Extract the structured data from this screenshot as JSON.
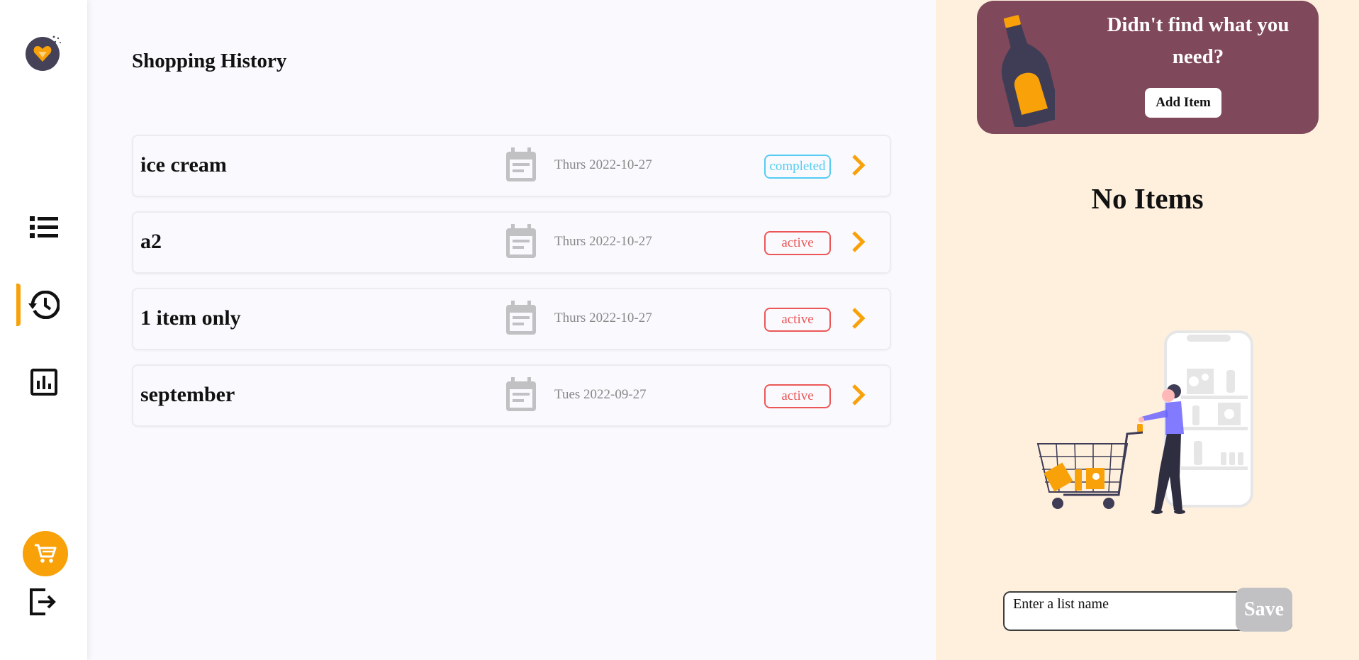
{
  "sidebar": {
    "items": [
      {
        "icon": "list-icon",
        "active": false
      },
      {
        "icon": "history-icon",
        "active": true
      },
      {
        "icon": "statistics-icon",
        "active": false
      }
    ]
  },
  "main": {
    "title": "Shopping History",
    "lists": [
      {
        "name": "ice cream",
        "date": "Thurs 2022-10-27",
        "status": "completed"
      },
      {
        "name": "a2",
        "date": "Thurs 2022-10-27",
        "status": "active"
      },
      {
        "name": "1 item only",
        "date": "Thurs 2022-10-27",
        "status": "active"
      },
      {
        "name": "september",
        "date": "Tues 2022-09-27",
        "status": "active"
      }
    ]
  },
  "right_panel": {
    "promo_text": "Didn't find what you need?",
    "promo_button": "Add Item",
    "empty_text": "No Items",
    "list_name_placeholder": "Enter a list name",
    "save_label": "Save"
  },
  "colors": {
    "accent": "#f9a109",
    "promo_bg": "#80485b",
    "right_bg": "#fff0de",
    "completed": "#56ccf2",
    "active": "#eb5757"
  }
}
